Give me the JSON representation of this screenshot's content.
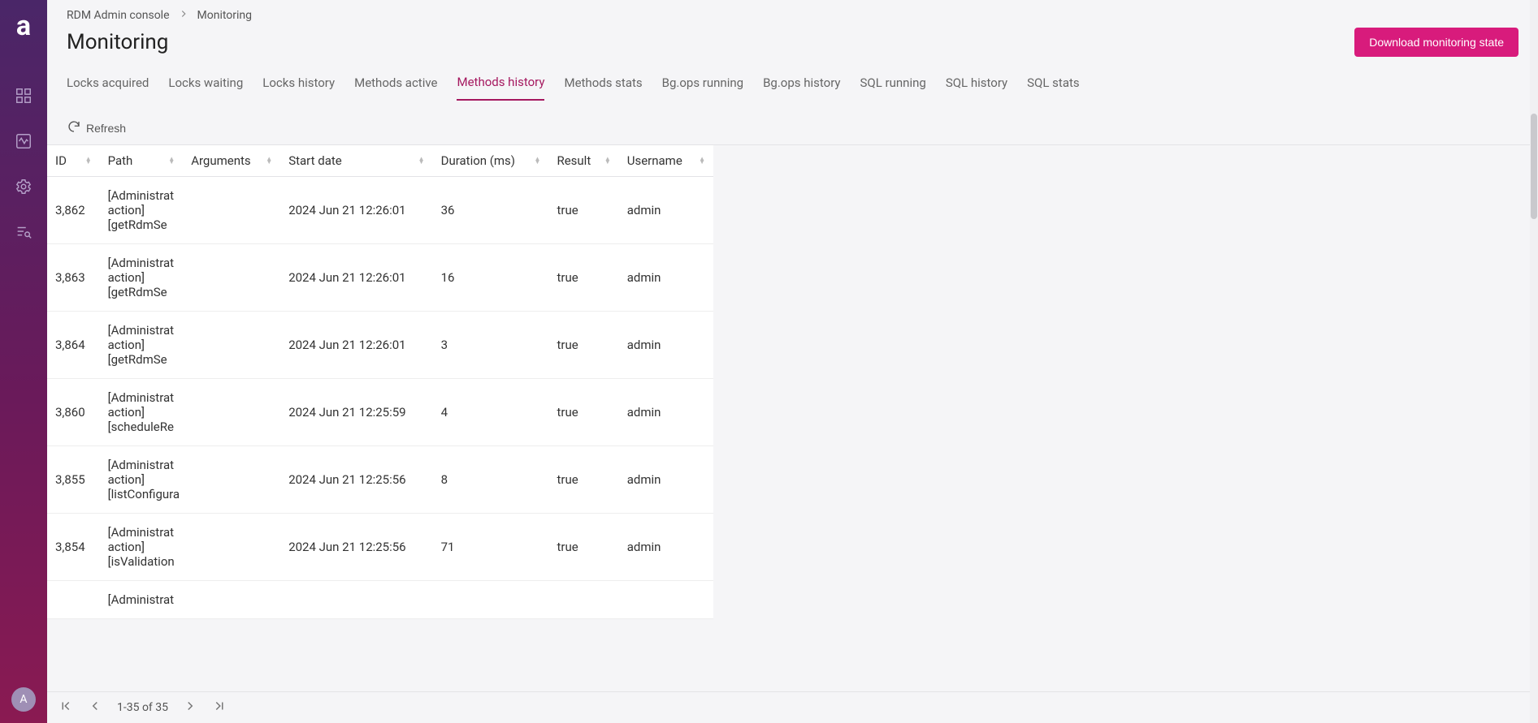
{
  "app": {
    "logo_letter": "a"
  },
  "sidebar": {
    "items": [
      {
        "name": "dashboard"
      },
      {
        "name": "monitoring"
      },
      {
        "name": "settings"
      },
      {
        "name": "query"
      }
    ],
    "avatar_letter": "A"
  },
  "breadcrumb": {
    "root": "RDM Admin console",
    "current": "Monitoring"
  },
  "page": {
    "title": "Monitoring",
    "download_button": "Download monitoring state",
    "refresh_label": "Refresh"
  },
  "tabs": [
    {
      "label": "Locks acquired",
      "active": false
    },
    {
      "label": "Locks waiting",
      "active": false
    },
    {
      "label": "Locks history",
      "active": false
    },
    {
      "label": "Methods active",
      "active": false
    },
    {
      "label": "Methods history",
      "active": true
    },
    {
      "label": "Methods stats",
      "active": false
    },
    {
      "label": "Bg.ops running",
      "active": false
    },
    {
      "label": "Bg.ops history",
      "active": false
    },
    {
      "label": "SQL running",
      "active": false
    },
    {
      "label": "SQL history",
      "active": false
    },
    {
      "label": "SQL stats",
      "active": false
    }
  ],
  "table": {
    "columns": [
      "ID",
      "Path",
      "Arguments",
      "Start date",
      "Duration (ms)",
      "Result",
      "Username"
    ],
    "rows": [
      {
        "id": "3,862",
        "path": "[Administrat action] [getRdmSe",
        "arguments": "",
        "start": "2024 Jun 21 12:26:01",
        "duration": "36",
        "result": "true",
        "username": "admin"
      },
      {
        "id": "3,863",
        "path": "[Administrat action] [getRdmSe",
        "arguments": "",
        "start": "2024 Jun 21 12:26:01",
        "duration": "16",
        "result": "true",
        "username": "admin"
      },
      {
        "id": "3,864",
        "path": "[Administrat action] [getRdmSe",
        "arguments": "",
        "start": "2024 Jun 21 12:26:01",
        "duration": "3",
        "result": "true",
        "username": "admin"
      },
      {
        "id": "3,860",
        "path": "[Administrat action] [scheduleRe",
        "arguments": "",
        "start": "2024 Jun 21 12:25:59",
        "duration": "4",
        "result": "true",
        "username": "admin"
      },
      {
        "id": "3,855",
        "path": "[Administrat action] [listConfigura",
        "arguments": "",
        "start": "2024 Jun 21 12:25:56",
        "duration": "8",
        "result": "true",
        "username": "admin"
      },
      {
        "id": "3,854",
        "path": "[Administrat action] [isValidation",
        "arguments": "",
        "start": "2024 Jun 21 12:25:56",
        "duration": "71",
        "result": "true",
        "username": "admin"
      },
      {
        "id": "",
        "path": "[Administrat",
        "arguments": "",
        "start": "",
        "duration": "",
        "result": "",
        "username": ""
      }
    ]
  },
  "pager": {
    "range_text": "1-35 of 35"
  }
}
